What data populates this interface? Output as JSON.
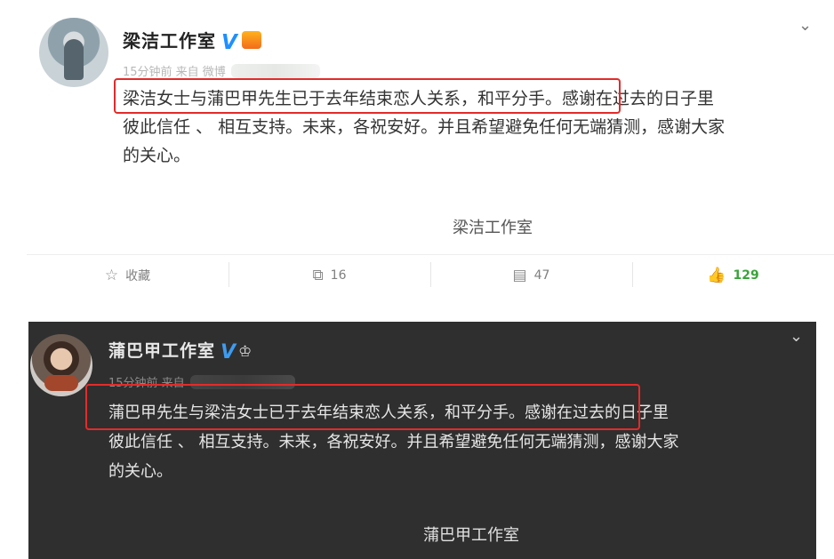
{
  "post1": {
    "account_name": "梁洁工作室",
    "verified_badge": "V",
    "meta_text": "15分钟前 来自 微博",
    "body_highlight": "梁洁女士与蒲巴甲先生已于去年结束恋人关系，和平分手。",
    "body_rest_line1": "感谢在过去的日子里",
    "body_line2": "彼此信任 、 相互支持。未来，各祝安好。并且希望避免任何无端猜测，感谢大家",
    "body_line3": "的关心。",
    "signature": "梁洁工作室",
    "actions": {
      "favorite_label": "收藏",
      "repost_count": "16",
      "comment_count": "47",
      "like_count": "129"
    }
  },
  "post2": {
    "account_name": "蒲巴甲工作室",
    "verified_badge": "V",
    "meta_text": "15分钟前 来自",
    "body_highlight": "蒲巴甲先生与梁洁女士已于去年结束恋人关系，和平分手。",
    "body_rest_line1": "感谢在过去的日子里",
    "body_line2": "彼此信任 、 相互支持。未来，各祝安好。并且希望避免任何无端猜测，感谢大家",
    "body_line3": "的关心。",
    "signature": "蒲巴甲工作室"
  },
  "icons": {
    "chevron": "chevron-down-icon",
    "favorite": "star-icon",
    "repost": "share-icon",
    "comment": "comment-icon",
    "like": "thumbs-up-icon",
    "crown": "crown-icon"
  },
  "colors": {
    "highlight_border": "#e32b2b",
    "verified_blue": "#1e90ff",
    "like_green": "#3aa43a",
    "dark_bg": "#2f2f2f"
  }
}
